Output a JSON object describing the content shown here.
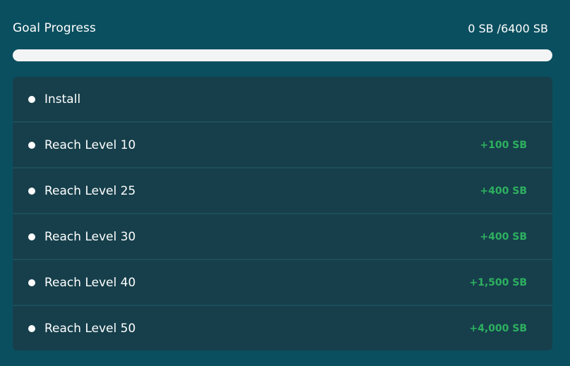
{
  "header": {
    "title": "Goal Progress",
    "total": "0 SB /6400 SB"
  },
  "progress": {
    "fraction": 0
  },
  "goals": [
    {
      "label": "Install",
      "reward": ""
    },
    {
      "label": "Reach Level 10",
      "reward": "+100 SB"
    },
    {
      "label": "Reach Level 25",
      "reward": "+400 SB"
    },
    {
      "label": "Reach Level 30",
      "reward": "+400 SB"
    },
    {
      "label": "Reach Level 40",
      "reward": "+1,500 SB"
    },
    {
      "label": "Reach Level 50",
      "reward": "+4,000 SB"
    }
  ],
  "colors": {
    "background": "#0a4f5f",
    "list_background": "#163f4b",
    "reward_green": "#2eb060",
    "progress_track": "#f3f4f5"
  }
}
